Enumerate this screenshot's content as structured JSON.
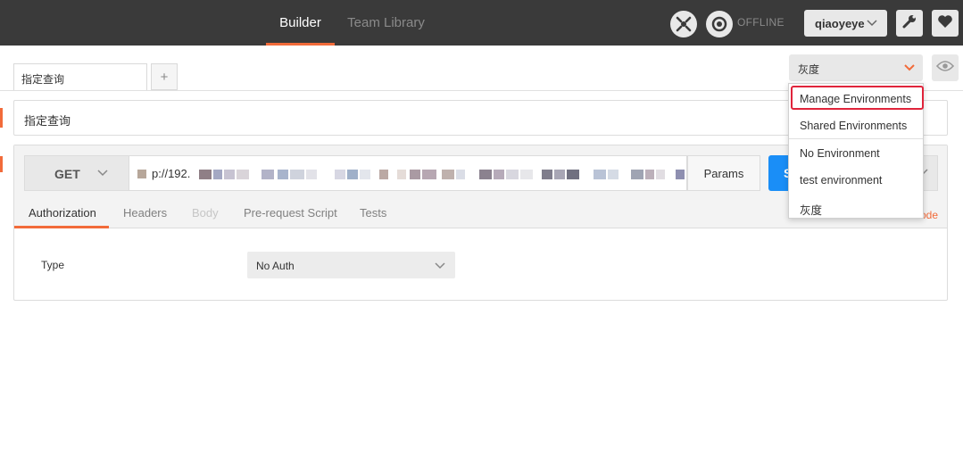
{
  "topbar": {
    "tabs": [
      {
        "label": "Builder",
        "active": true
      },
      {
        "label": "Team Library",
        "active": false
      }
    ],
    "status": "OFFLINE",
    "user": "qiaoyeye",
    "icons": [
      "sync-icon",
      "offline-icon",
      "wrench-icon",
      "heart-icon"
    ]
  },
  "environment": {
    "selected": "灰度",
    "menu": [
      {
        "label": "Manage Environments",
        "highlighted": true
      },
      {
        "label": "Shared Environments"
      },
      {
        "label": "No Environment"
      },
      {
        "label": "test environment"
      },
      {
        "label": "灰度"
      }
    ]
  },
  "request_tabs": {
    "active_tab": "指定查询",
    "add_label": "+"
  },
  "request": {
    "name": "指定查询",
    "method": "GET",
    "url_visible": "p://192.",
    "params_label": "Params",
    "send_label": "S",
    "code_label": "ode"
  },
  "subtabs": [
    {
      "label": "Authorization",
      "state": "active"
    },
    {
      "label": "Headers",
      "state": "normal"
    },
    {
      "label": "Body",
      "state": "disabled"
    },
    {
      "label": "Pre-request Script",
      "state": "normal"
    },
    {
      "label": "Tests",
      "state": "normal"
    }
  ],
  "auth": {
    "type_label": "Type",
    "type_value": "No Auth"
  },
  "colors": {
    "accent": "#f26b3a",
    "send": "#1a8ef7",
    "highlight": "#e0243b",
    "topbar": "#3a3a3a"
  }
}
